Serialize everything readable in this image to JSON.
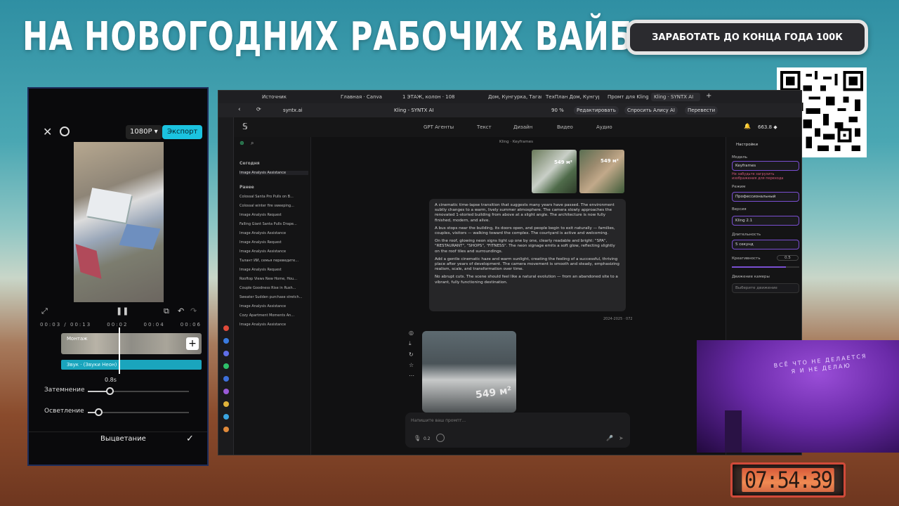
{
  "banner": {
    "text": "НА НОВОГОДНИХ РАБОЧИХ ВАЙБАХ"
  },
  "earn_button": {
    "label": "ЗАРАБОТАТЬ ДО КОНЦА ГОДА 100К"
  },
  "timer": {
    "value": "07:54:39"
  },
  "phone": {
    "resolution": "1080P ▾",
    "export": "Экспорт",
    "time_current": "00:03",
    "time_total": "00:13",
    "time_ticks": [
      "00:02",
      "00:04",
      "00:06"
    ],
    "clip_label": "Монтаж",
    "audio_label": "Звук · (Звуки Неон)",
    "fade_in_label": "Затемнение",
    "fade_in_value": "0.8s",
    "fade_out_label": "Осветление",
    "fade_title": "Выцветание"
  },
  "browser": {
    "tabs": [
      "Источник",
      "Главная · Canva",
      "1 ЭТАЖ, колон · 1080",
      "Дом, Кунгурка, Тагам",
      "ТехПлан Дом, Кунгур",
      "Промт для Kling",
      "Kling · SYNTX AI"
    ],
    "url": "syntx.ai",
    "page_title": "Kling - SYNTX AI",
    "zoom": "90 %",
    "edit_btn": "Редактировать",
    "ask_btn": "Спросить Алису AI",
    "translate_btn": "Перевести",
    "nav": [
      "GPT Агенты",
      "Текст",
      "Дизайн",
      "Видео",
      "Аудио"
    ],
    "balance": "663.8 ◆",
    "breadcrumb": "Kling · Keyframes"
  },
  "sidebar": {
    "today": "Сегодня",
    "earlier": "Ранее",
    "today_items": [
      "Image Analysis Assistance"
    ],
    "items": [
      "Colossal Santa Pro Pulls on B...",
      "Colossal winter fire sweeping...",
      "Image Analysis Request",
      "Falling Giant Santa Pulls Drape...",
      "Image Analysis Assistance",
      "Image Analysis Request",
      "Image Analysis Assistance",
      "Талант ИИ, семья переведите...",
      "Image Analysis Request",
      "Rooftop Views New Home, Hou...",
      "Couple Goodness Rise in Rush...",
      "Sweater Sudden purchase stretch...",
      "Image Analysis Assistance",
      "Cozy Apartment Moments An...",
      "Image Analysis Assistance"
    ]
  },
  "chat": {
    "image_labels": [
      "549 м²",
      "549 м²"
    ],
    "paragraphs": [
      "A cinematic time-lapse transition that suggests many years have passed. The environment subtly changes to a warm, lively summer atmosphere. The camera slowly approaches the renovated 1-storied building from above at a slight angle. The architecture is now fully finished, modern, and alive.",
      "A bus stops near the building, its doors open, and people begin to exit naturally — families, couples, visitors — walking toward the complex. The courtyard is active and welcoming.",
      "On the roof, glowing neon signs light up one by one, clearly readable and bright: \"SPA\", \"RESTAURANT\", \"SHOPS\", \"FITNESS\". The neon signage emits a soft glow, reflecting slightly on the roof tiles and surroundings.",
      "Add a gentle cinematic haze and warm sunlight, creating the feeling of a successful, thriving place after years of development. The camera movement is smooth and steady, emphasizing realism, scale, and transformation over time.",
      "No abrupt cuts. The scene should feel like a natural evolution — from an abandoned site to a vibrant, fully functioning destination."
    ],
    "date": "2024-2025 · 072",
    "video_label": "549 м²",
    "input_placeholder": "Напишите ваш промпт...",
    "cost": "0.2"
  },
  "settings": {
    "title": "Настройки",
    "model_label": "Модель",
    "model_value": "Keyframes",
    "warning": "Не забудьте загрузить изображения для перехода",
    "mode_label": "Режим",
    "mode_value": "Профессиональный",
    "version_label": "Версия",
    "version_value": "Kling 2.1",
    "duration_label": "Длительность",
    "duration_value": "5 секунд",
    "creativity_label": "Креативность",
    "creativity_value": "0.5",
    "camera_label": "Движение камеры",
    "camera_value": "Выберите движение"
  },
  "webcam": {
    "wall_text_1": "ВСЁ ЧТО НЕ ДЕЛАЕТСЯ",
    "wall_text_2": "Я И НЕ ДЕЛАЮ"
  },
  "colors": {
    "accent": "#1bc3e0",
    "purple": "#7a4fd1",
    "timer_red": "#d14a3a"
  }
}
